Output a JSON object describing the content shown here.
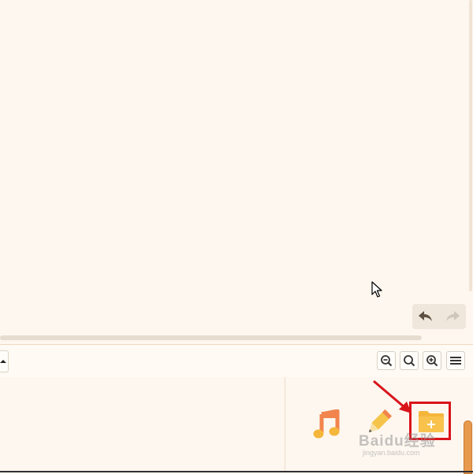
{
  "colors": {
    "background": "#fdf7ef",
    "toolbar_bg": "#fffaf4",
    "highlight": "#d9141b",
    "accent_orange": "#e89a4c",
    "music_icon": "#f2844e",
    "pencil_icon": "#f5c44a",
    "folder_icon": "#f5b63c"
  },
  "canvas": {
    "undo_icon": "undo-icon",
    "redo_icon": "redo-icon",
    "cursor_icon": "mouse-pointer-icon"
  },
  "toolbar": {
    "panel_toggle_icon": "caret-up-icon",
    "zoom_out_icon": "zoom-out-icon",
    "zoom_reset_icon": "zoom-reset-icon",
    "zoom_in_icon": "zoom-in-icon",
    "menu_icon": "hamburger-menu-icon"
  },
  "bottom_panel": {
    "tools": [
      {
        "name": "music",
        "icon": "music-note-icon"
      },
      {
        "name": "pencil",
        "icon": "pencil-icon"
      },
      {
        "name": "new-folder",
        "icon": "folder-plus-icon",
        "highlighted": true
      }
    ]
  },
  "watermark": {
    "brand": "Baidu经验",
    "url": "jingyan.baidu.com"
  }
}
